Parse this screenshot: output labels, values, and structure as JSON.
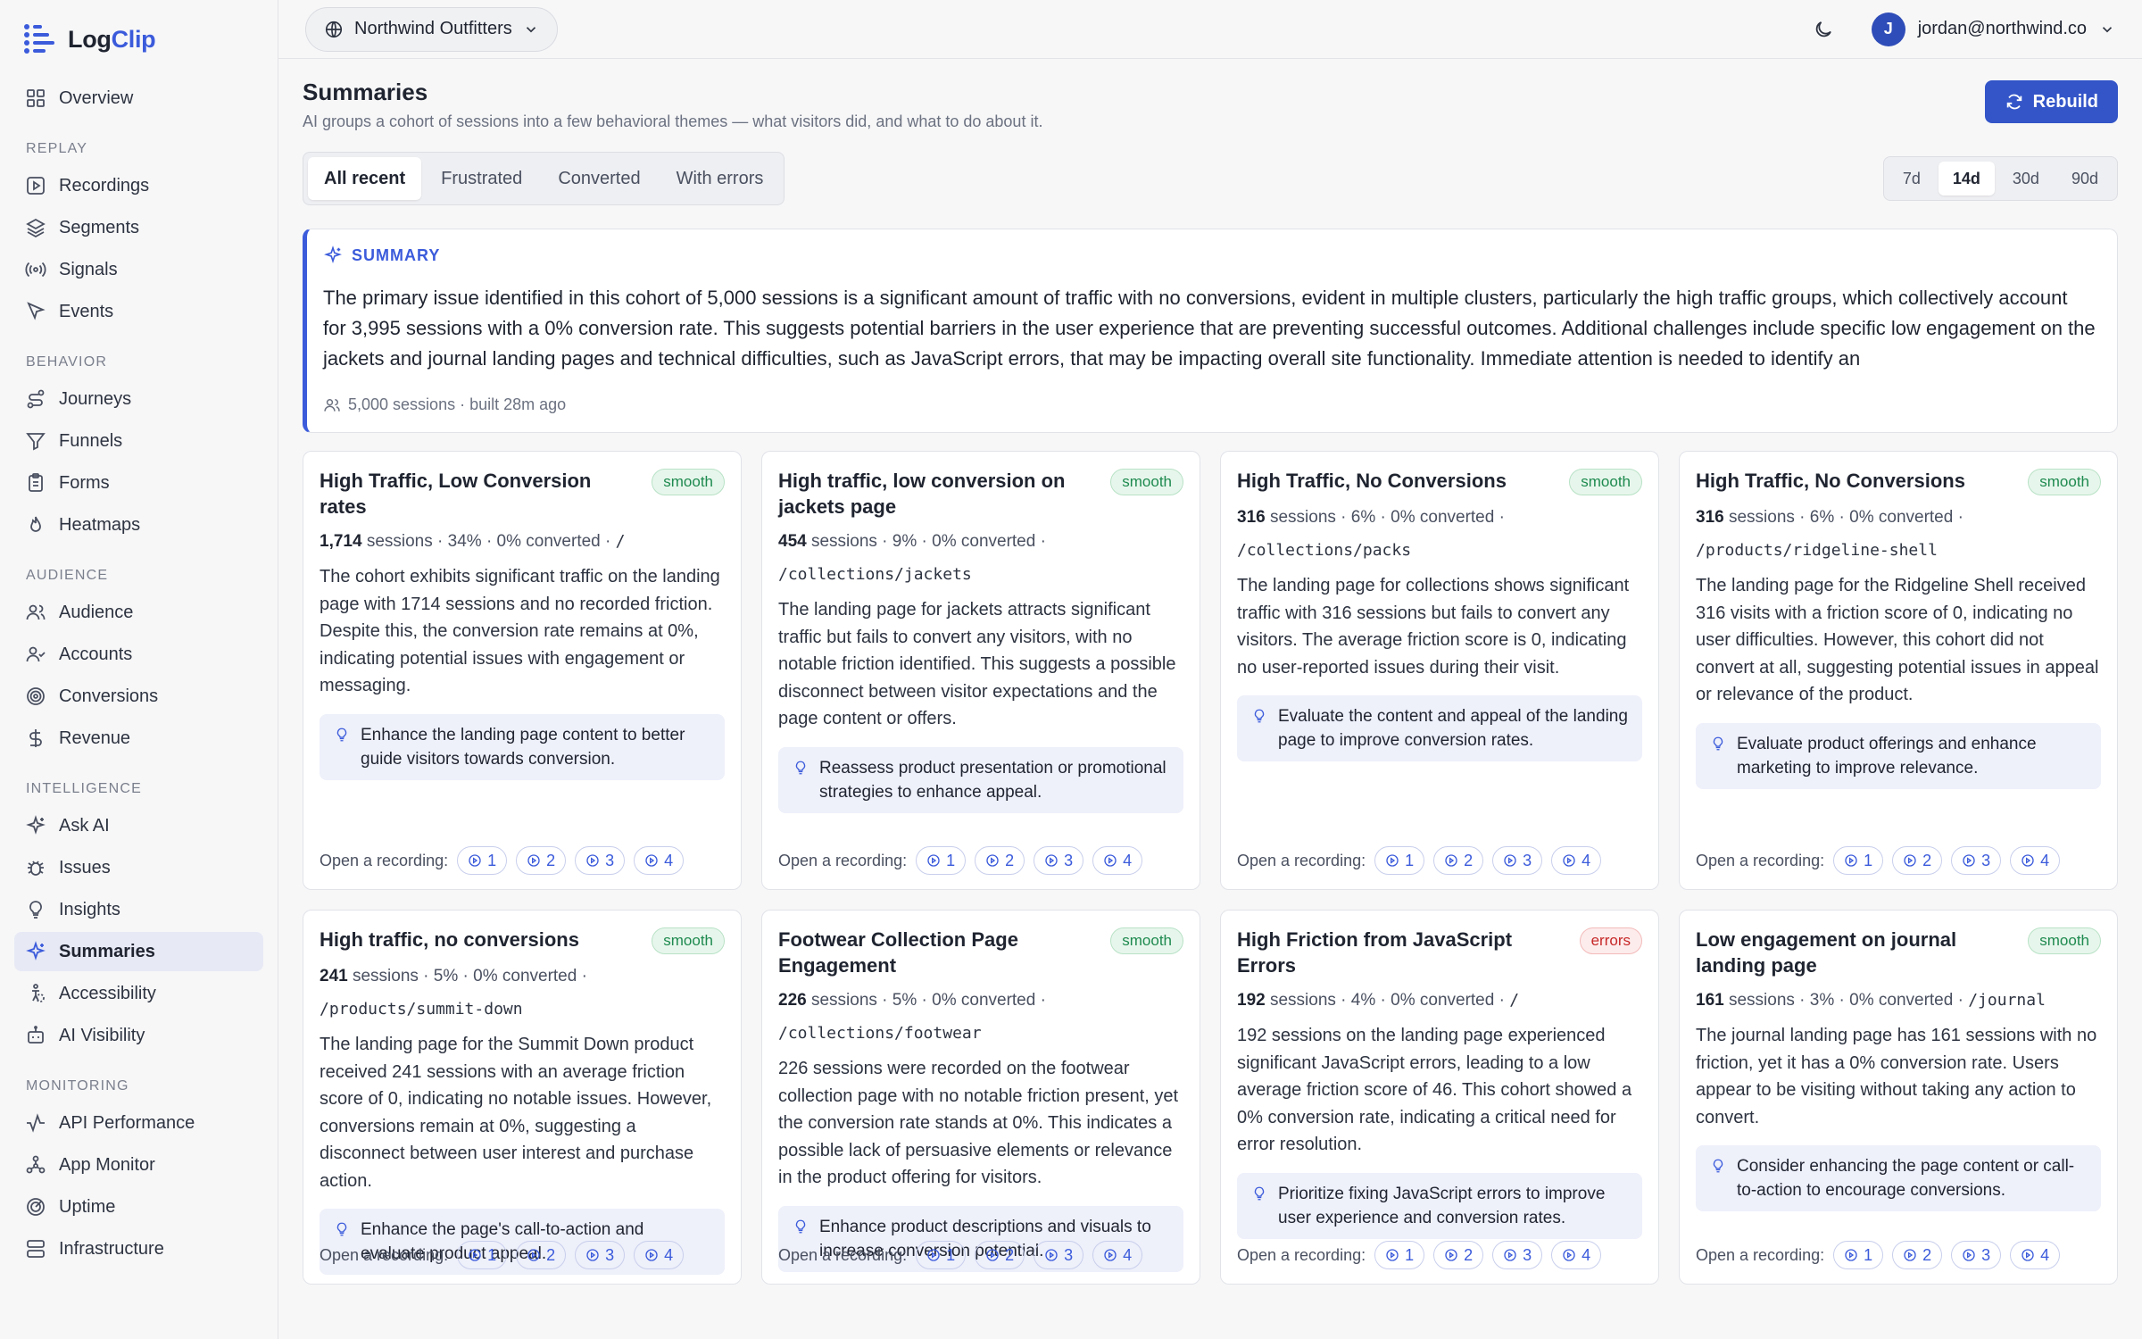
{
  "brand": {
    "name_prefix": "Log",
    "name_accent": "Clip"
  },
  "sidebar": {
    "overview": "Overview",
    "sections": [
      {
        "title": "REPLAY",
        "items": [
          {
            "label": "Recordings",
            "icon": "play-square-icon"
          },
          {
            "label": "Segments",
            "icon": "layers-icon"
          },
          {
            "label": "Signals",
            "icon": "signal-icon"
          },
          {
            "label": "Events",
            "icon": "cursor-icon"
          }
        ]
      },
      {
        "title": "BEHAVIOR",
        "items": [
          {
            "label": "Journeys",
            "icon": "route-icon"
          },
          {
            "label": "Funnels",
            "icon": "funnel-icon"
          },
          {
            "label": "Forms",
            "icon": "clipboard-icon"
          },
          {
            "label": "Heatmaps",
            "icon": "flame-icon"
          }
        ]
      },
      {
        "title": "AUDIENCE",
        "items": [
          {
            "label": "Audience",
            "icon": "users-icon"
          },
          {
            "label": "Accounts",
            "icon": "user-check-icon"
          },
          {
            "label": "Conversions",
            "icon": "target-icon"
          },
          {
            "label": "Revenue",
            "icon": "dollar-icon"
          }
        ]
      },
      {
        "title": "INTELLIGENCE",
        "items": [
          {
            "label": "Ask AI",
            "icon": "sparkles-icon"
          },
          {
            "label": "Issues",
            "icon": "bug-icon"
          },
          {
            "label": "Insights",
            "icon": "lightbulb-icon"
          },
          {
            "label": "Summaries",
            "icon": "sparkles-icon",
            "active": true
          },
          {
            "label": "Accessibility",
            "icon": "accessibility-icon"
          },
          {
            "label": "AI Visibility",
            "icon": "robot-icon"
          }
        ]
      },
      {
        "title": "MONITORING",
        "items": [
          {
            "label": "API Performance",
            "icon": "activity-icon"
          },
          {
            "label": "App Monitor",
            "icon": "network-icon"
          },
          {
            "label": "Uptime",
            "icon": "radar-icon"
          },
          {
            "label": "Infrastructure",
            "icon": "server-icon"
          }
        ]
      }
    ]
  },
  "topbar": {
    "org": "Northwind Outfitters",
    "user_initial": "J",
    "user_email": "jordan@northwind.co"
  },
  "page": {
    "title": "Summaries",
    "subtitle": "AI groups a cohort of sessions into a few behavioral themes — what visitors did, and what to do about it.",
    "rebuild_label": "Rebuild",
    "filters": [
      "All recent",
      "Frustrated",
      "Converted",
      "With errors"
    ],
    "ranges": [
      "7d",
      "14d",
      "30d",
      "90d"
    ]
  },
  "summary": {
    "label": "SUMMARY",
    "text": "The primary issue identified in this cohort of 5,000 sessions is a significant amount of traffic with no conversions, evident in multiple clusters, particularly the high traffic groups, which collectively account for 3,995 sessions with a 0% conversion rate. This suggests potential barriers in the user experience that are preventing successful outcomes. Additional challenges include specific low engagement on the jackets and journal landing pages and technical difficulties, such as JavaScript errors, that may be impacting overall site functionality. Immediate attention is needed to identify an",
    "meta": "5,000 sessions · built 28m ago"
  },
  "recording_label": "Open a recording:",
  "recording_chips": [
    "1",
    "2",
    "3",
    "4"
  ],
  "clusters": [
    {
      "title": "High Traffic, Low Conversion rates",
      "badge": "smooth",
      "sessions": "1,714",
      "stats": "sessions · 34%  ·  0% converted  ·",
      "path": "/",
      "body": "The cohort exhibits significant traffic on the landing page with 1714 sessions and no recorded friction. Despite this, the conversion rate remains at 0%, indicating potential issues with engagement or messaging.",
      "tip": "Enhance the landing page content to better guide visitors towards conversion."
    },
    {
      "title": "High traffic, low conversion on jackets page",
      "badge": "smooth",
      "sessions": "454",
      "stats": "sessions · 9%  ·  0% converted  ·",
      "path": "/collections/jackets",
      "body": "The landing page for jackets attracts significant traffic but fails to convert any visitors, with no notable friction identified. This suggests a possible disconnect between visitor expectations and the page content or offers.",
      "tip": "Reassess product presentation or promotional strategies to enhance appeal."
    },
    {
      "title": "High Traffic, No Conversions",
      "badge": "smooth",
      "sessions": "316",
      "stats": "sessions · 6%  ·  0% converted  ·",
      "path": "/collections/packs",
      "body": "The landing page for collections shows significant traffic with 316 sessions but fails to convert any visitors. The average friction score is 0, indicating no user-reported issues during their visit.",
      "tip": "Evaluate the content and appeal of the landing page to improve conversion rates."
    },
    {
      "title": "High Traffic, No Conversions",
      "badge": "smooth",
      "sessions": "316",
      "stats": "sessions · 6%  ·  0% converted  ·",
      "path": "/products/ridgeline-shell",
      "body": "The landing page for the Ridgeline Shell received 316 visits with a friction score of 0, indicating no user difficulties. However, this cohort did not convert at all, suggesting potential issues in appeal or relevance of the product.",
      "tip": "Evaluate product offerings and enhance marketing to improve relevance."
    },
    {
      "title": "High traffic, no conversions",
      "badge": "smooth",
      "sessions": "241",
      "stats": "sessions · 5%  ·  0% converted  ·",
      "path": "/products/summit-down",
      "body": "The landing page for the Summit Down product received 241 sessions with an average friction score of 0, indicating no notable issues. However, conversions remain at 0%, suggesting a disconnect between user interest and purchase action.",
      "tip": "Enhance the page's call-to-action and evaluate product appeal."
    },
    {
      "title": "Footwear Collection Page Engagement",
      "badge": "smooth",
      "sessions": "226",
      "stats": "sessions · 5%  ·  0% converted  ·",
      "path": "/collections/footwear",
      "body": "226 sessions were recorded on the footwear collection page with no notable friction present, yet the conversion rate stands at 0%. This indicates a possible lack of persuasive elements or relevance in the product offering for visitors.",
      "tip": "Enhance product descriptions and visuals to increase conversion potential."
    },
    {
      "title": "High Friction from JavaScript Errors",
      "badge": "errors",
      "sessions": "192",
      "stats": "sessions · 4%  ·  0% converted  ·",
      "path": "/",
      "body": "192 sessions on the landing page experienced significant JavaScript errors, leading to a low average friction score of 46. This cohort showed a 0% conversion rate, indicating a critical need for error resolution.",
      "tip": "Prioritize fixing JavaScript errors to improve user experience and conversion rates."
    },
    {
      "title": "Low engagement on journal landing page",
      "badge": "smooth",
      "sessions": "161",
      "stats": "sessions · 3%  ·  0% converted  ·",
      "path": "/journal",
      "body": "The journal landing page has 161 sessions with no friction, yet it has a 0% conversion rate. Users appear to be visiting without taking any action to convert.",
      "tip": "Consider enhancing the page content or call-to-action to encourage conversions."
    }
  ]
}
